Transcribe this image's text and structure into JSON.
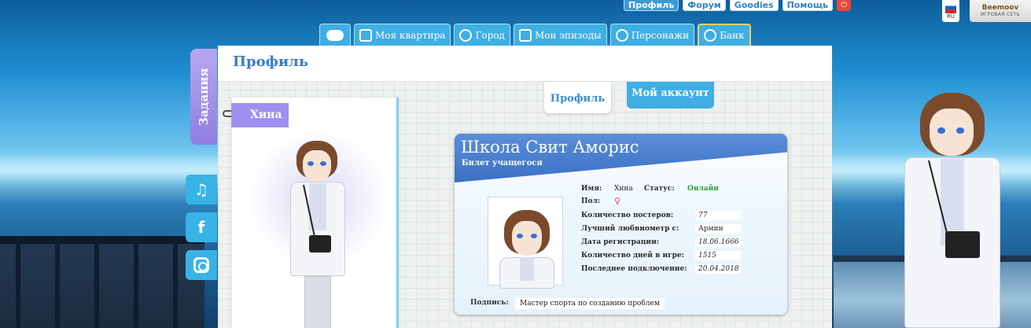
{
  "topbar": {
    "buttons": [
      "Профиль",
      "Форум",
      "Goodies",
      "Помощь"
    ],
    "power_icon": "power-icon",
    "lang": "RU",
    "brand_name": "Beemoov",
    "brand_sub": "ИГРОВАЯ СЕТЬ"
  },
  "nav": {
    "tabs": [
      "Моя квартира",
      "Город",
      "Мои эпизоды",
      "Персонажи",
      "Банк"
    ]
  },
  "side": {
    "quests_label": "Задания"
  },
  "panel": {
    "title": "Профиль",
    "name_tag": "Хина",
    "subtabs": {
      "profile": "Профиль",
      "account": "Мой аккаунт"
    }
  },
  "card": {
    "title": "Школа Свит Аморис",
    "subtitle": "Билет учащегося",
    "name_label": "Имя:",
    "name_value": "Хина",
    "status_label": "Статус:",
    "status_value": "Онлайн",
    "gender_label": "Пол:",
    "gender_value": "♀",
    "stats": [
      {
        "label": "Количество постеров:",
        "value": "77"
      },
      {
        "label": "Лучший любвиометр с:",
        "value": "Армин"
      },
      {
        "label": "Дата регистрации:",
        "value": "18.06.1666"
      },
      {
        "label": "Количество дней в игре:",
        "value": "1515"
      },
      {
        "label": "Последнее подключение:",
        "value": "20.04.2018"
      }
    ],
    "signature_label": "Подпись:",
    "signature_value": "Мастер спорта по созданию проблем"
  },
  "colors": {
    "accent": "#3eaee3",
    "title_blue": "#3a7ec2",
    "online_green": "#2f9a35",
    "quests_purple": "#9e8ff0"
  }
}
